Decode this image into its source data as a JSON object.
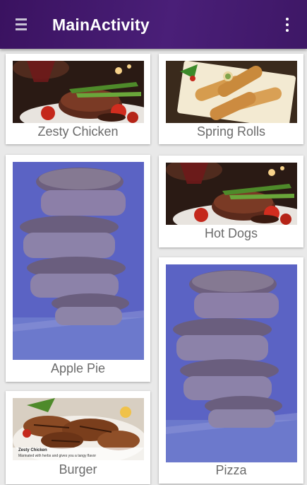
{
  "app_bar": {
    "title": "MainActivity",
    "menu_icon": "hamburger-menu-icon",
    "overflow_icon": "more-vertical-icon",
    "background": "#3e1766"
  },
  "grid": {
    "items": [
      {
        "label": "Zesty Chicken",
        "image": "steak-dinner-image"
      },
      {
        "label": "Spring Rolls",
        "image": "spring-rolls-image"
      },
      {
        "label": "Hot Dogs",
        "image": "steak-dinner-image"
      },
      {
        "label": "Apple Pie",
        "image": "ice-cream-sandwich-image"
      },
      {
        "label": "Pizza",
        "image": "ice-cream-sandwich-image"
      },
      {
        "label": "Burger",
        "image": "grilled-chicken-image",
        "image_caption_title": "Zesty Chicken",
        "image_caption_text": "Marinated with herbs and gives you a tangy flavor"
      }
    ]
  }
}
